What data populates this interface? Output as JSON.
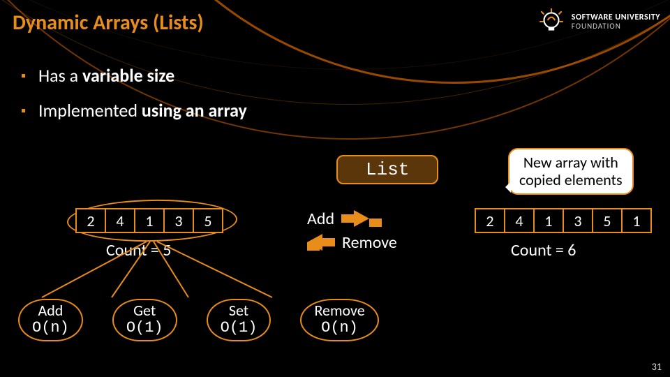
{
  "title": "Dynamic Arrays (Lists)",
  "logo": {
    "line1": "SOFTWARE UNIVERSITY",
    "line2": "FOUNDATION"
  },
  "bullets": {
    "b1_pre": "Has a ",
    "b1_bold": "variable size",
    "b2_pre": "Implemented ",
    "b2_bold": "using an array"
  },
  "list_label": "List",
  "bubble": {
    "l1": "New array with",
    "l2": "copied elements"
  },
  "array1": [
    "2",
    "4",
    "1",
    "3",
    "5"
  ],
  "array2": [
    "2",
    "4",
    "1",
    "3",
    "5",
    "1"
  ],
  "count1": "Count = 5",
  "count2": "Count = 6",
  "add_label": "Add",
  "remove_label": "Remove",
  "ops": [
    {
      "name": "Add",
      "big": "O(n)"
    },
    {
      "name": "Get",
      "big": "O(1)"
    },
    {
      "name": "Set",
      "big": "O(1)"
    },
    {
      "name": "Remove",
      "big": "O(n)"
    }
  ],
  "slide_number": "31"
}
